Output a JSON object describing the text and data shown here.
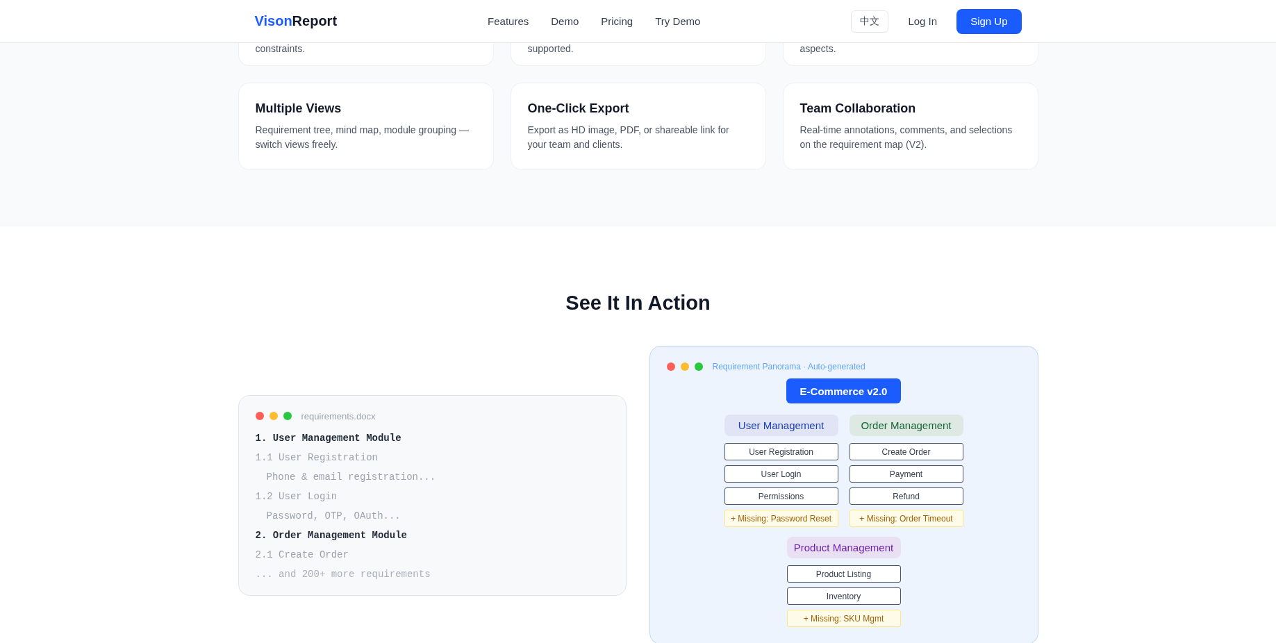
{
  "header": {
    "logo": {
      "accent": "Vison",
      "rest": "Report"
    },
    "nav": [
      "Features",
      "Demo",
      "Pricing",
      "Try Demo"
    ],
    "language": "中文",
    "login": "Log In",
    "signup": "Sign Up"
  },
  "features_partial": [
    "constraints.",
    "supported.",
    "aspects."
  ],
  "features": [
    {
      "title": "Multiple Views",
      "description": "Requirement tree, mind map, module grouping — switch views freely."
    },
    {
      "title": "One-Click Export",
      "description": "Export as HD image, PDF, or shareable link for your team and clients."
    },
    {
      "title": "Team Collaboration",
      "description": "Real-time annotations, comments, and selections on the requirement map (V2)."
    }
  ],
  "demo_title": "See It In Action",
  "document": {
    "filename": "requirements.docx",
    "lines": [
      {
        "kind": "heading",
        "text": "1. User Management Module"
      },
      {
        "kind": "item",
        "text": "1.1 User Registration"
      },
      {
        "kind": "detail",
        "text": "Phone & email registration..."
      },
      {
        "kind": "item",
        "text": "1.2 User Login"
      },
      {
        "kind": "detail",
        "text": "Password, OTP, OAuth..."
      },
      {
        "kind": "heading",
        "text": "2. Order Management Module"
      },
      {
        "kind": "item",
        "text": "2.1 Create Order"
      },
      {
        "kind": "more",
        "text": "... and 200+ more requirements"
      }
    ]
  },
  "panorama": {
    "title": "Requirement Panorama · Auto-generated",
    "root": "E-Commerce v2.0",
    "groups": [
      {
        "name": "User Management",
        "color": "#1e40af",
        "items": [
          {
            "kind": "feature",
            "text": "User Registration"
          },
          {
            "kind": "feature",
            "text": "User Login"
          },
          {
            "kind": "feature",
            "text": "Permissions"
          },
          {
            "kind": "missing",
            "text": "+ Missing: Password Reset"
          }
        ]
      },
      {
        "name": "Order Management",
        "color": "#166534",
        "items": [
          {
            "kind": "feature",
            "text": "Create Order"
          },
          {
            "kind": "feature",
            "text": "Payment"
          },
          {
            "kind": "feature",
            "text": "Refund"
          },
          {
            "kind": "missing",
            "text": "+ Missing: Order Timeout"
          }
        ]
      },
      {
        "name": "Product Management",
        "color": "#6b21a8",
        "items": [
          {
            "kind": "feature",
            "text": "Product Listing"
          },
          {
            "kind": "feature",
            "text": "Inventory"
          },
          {
            "kind": "missing",
            "text": "+ Missing: SKU Mgmt"
          }
        ]
      }
    ]
  }
}
